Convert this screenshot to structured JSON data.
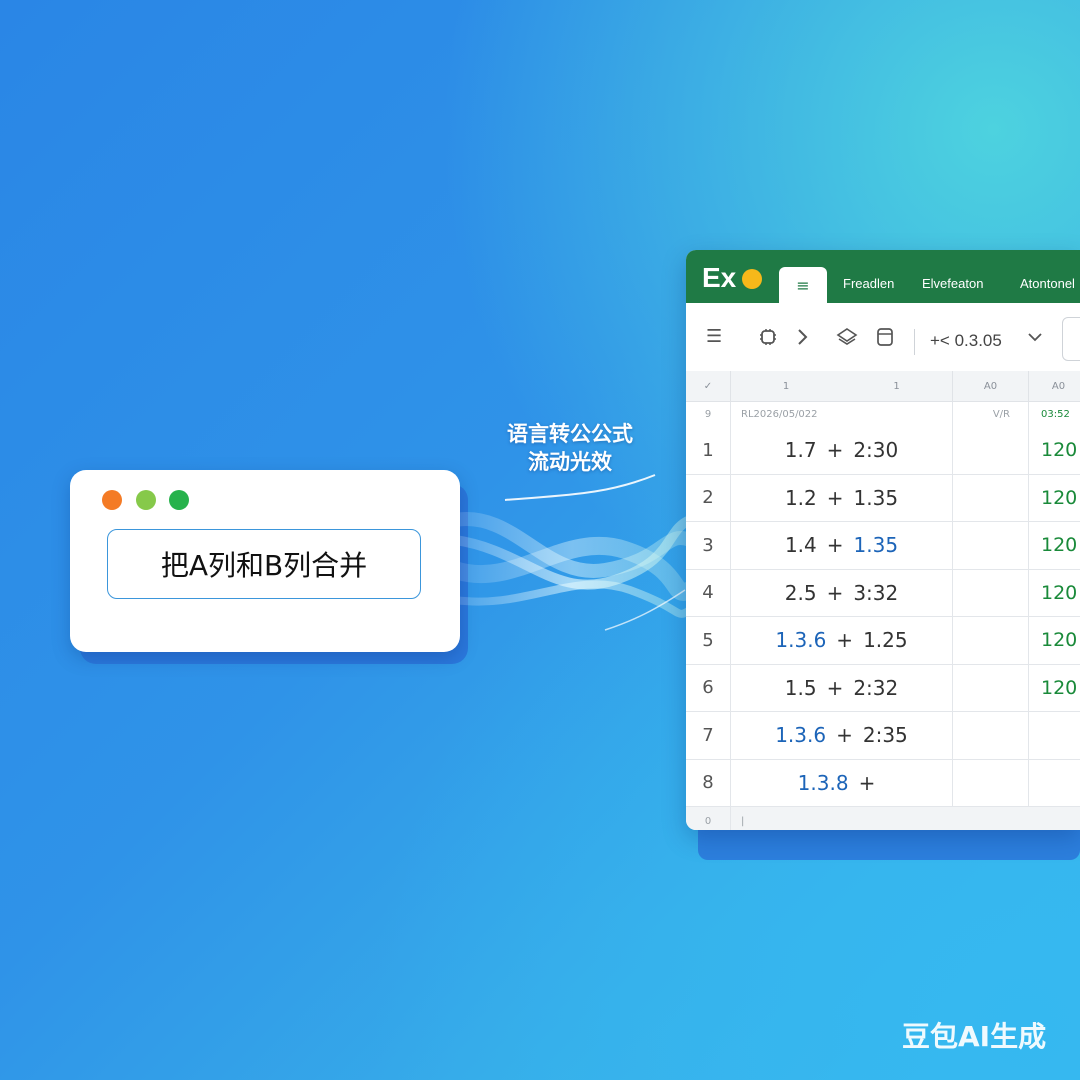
{
  "prompt_card": {
    "input_text": "把A列和B列合并"
  },
  "flow_label": {
    "line1": "语言转公公式",
    "line2": "流动光效"
  },
  "spreadsheet": {
    "logo": "Ex",
    "tabs": [
      "≡",
      "Freadlen",
      "Elvefeaton",
      "Atontonel"
    ],
    "toolbar_value": "+< 0.3.05",
    "header_cols": [
      "✓",
      "1",
      "1",
      "A0",
      "A0"
    ],
    "sub_header": [
      "9",
      "RL2026/05/022",
      "V/R",
      "03:52"
    ],
    "rows": [
      {
        "num": "1",
        "a_left": "1.7",
        "a_right": "2:30",
        "a_left_blue": false,
        "a_right_blue": false,
        "c": "120"
      },
      {
        "num": "2",
        "a_left": "1.2",
        "a_right": "1.35",
        "a_left_blue": false,
        "a_right_blue": false,
        "c": "120"
      },
      {
        "num": "3",
        "a_left": "1.4",
        "a_right": "1.35",
        "a_left_blue": false,
        "a_right_blue": true,
        "c": "120"
      },
      {
        "num": "4",
        "a_left": "2.5",
        "a_right": "3:32",
        "a_left_blue": false,
        "a_right_blue": false,
        "c": "120"
      },
      {
        "num": "5",
        "a_left": "1.3.6",
        "a_right": "1.25",
        "a_left_blue": true,
        "a_right_blue": false,
        "c": "120"
      },
      {
        "num": "6",
        "a_left": "1.5",
        "a_right": "2:32",
        "a_left_blue": false,
        "a_right_blue": false,
        "c": "120"
      },
      {
        "num": "7",
        "a_left": "1.3.6",
        "a_right": "2:35",
        "a_left_blue": true,
        "a_right_blue": false,
        "c": ""
      },
      {
        "num": "8",
        "a_left": "1.3.8",
        "a_right": "",
        "a_left_blue": true,
        "a_right_blue": false,
        "c": ""
      }
    ],
    "footer": [
      "0",
      "|"
    ]
  },
  "watermark": "豆包AI生成",
  "colors": {
    "ribbon": "#1f7a45",
    "accent_green": "#1a8a3a",
    "accent_blue": "#1c64b8"
  }
}
